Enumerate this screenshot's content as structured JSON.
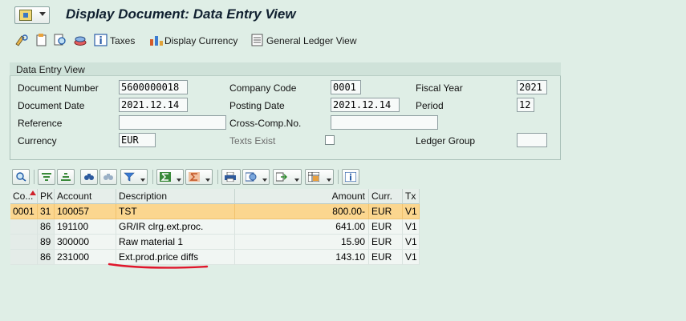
{
  "window": {
    "title": "Display Document: Data Entry View"
  },
  "toolbar": {
    "taxes_label": "Taxes",
    "display_currency_label": "Display Currency",
    "gl_view_label": "General Ledger View"
  },
  "header": {
    "group_title": "Data Entry View",
    "labels": {
      "document_number": "Document Number",
      "company_code": "Company Code",
      "fiscal_year": "Fiscal Year",
      "document_date": "Document Date",
      "posting_date": "Posting Date",
      "period": "Period",
      "reference": "Reference",
      "cross_comp": "Cross-Comp.No.",
      "currency": "Currency",
      "texts_exist": "Texts Exist",
      "ledger_group": "Ledger Group"
    },
    "values": {
      "document_number": "5600000018",
      "company_code": "0001",
      "fiscal_year": "2021",
      "document_date": "2021.12.14",
      "posting_date": "2021.12.14",
      "period": "12",
      "reference": "",
      "cross_comp": "",
      "currency": "EUR",
      "ledger_group": ""
    }
  },
  "table": {
    "columns": [
      "Co...",
      "PK",
      "Account",
      "Description",
      "Amount",
      "Curr.",
      "Tx"
    ],
    "rows": [
      {
        "co": "0001",
        "pk": "31",
        "account": "100057",
        "description": "TST",
        "amount": "800.00-",
        "curr": "EUR",
        "tx": "V1"
      },
      {
        "co": "",
        "pk": "86",
        "account": "191100",
        "description": "GR/IR clrg.ext.proc.",
        "amount": "641.00",
        "curr": "EUR",
        "tx": "V1"
      },
      {
        "co": "",
        "pk": "89",
        "account": "300000",
        "description": "Raw material 1",
        "amount": "15.90",
        "curr": "EUR",
        "tx": "V1"
      },
      {
        "co": "",
        "pk": "86",
        "account": "231000",
        "description": "Ext.prod.price diffs",
        "amount": "143.10",
        "curr": "EUR",
        "tx": "V1"
      }
    ]
  },
  "colors": {
    "background": "#dfeee6",
    "selected_row": "#fbd68f",
    "annotation": "#e0162b"
  }
}
